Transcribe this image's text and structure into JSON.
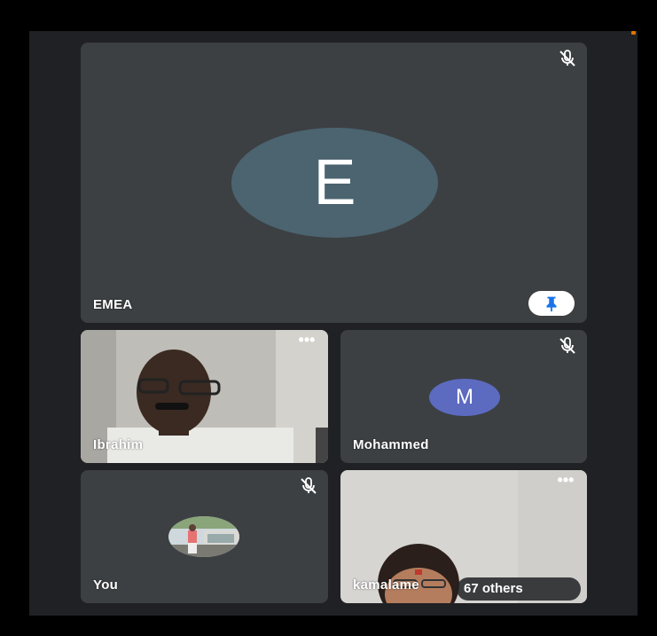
{
  "participants": {
    "main": {
      "name": "EMEA",
      "initial": "E",
      "avatar_color": "#4b6470",
      "muted": true,
      "pinned": true
    },
    "ibrahim": {
      "name": "Ibrahim",
      "has_video": true,
      "menu": "•••"
    },
    "mohammed": {
      "name": "Mohammed",
      "initial": "M",
      "avatar_color": "#5c6bc0",
      "muted": true
    },
    "you": {
      "name": "You",
      "muted": true
    },
    "kamalame": {
      "name": "kamalame",
      "has_video": true,
      "menu": "•••"
    }
  },
  "others_count_label": "67 others",
  "colors": {
    "tile_bg": "#3c4043",
    "stage_bg": "#202124",
    "pin_blue": "#1a73e8"
  }
}
